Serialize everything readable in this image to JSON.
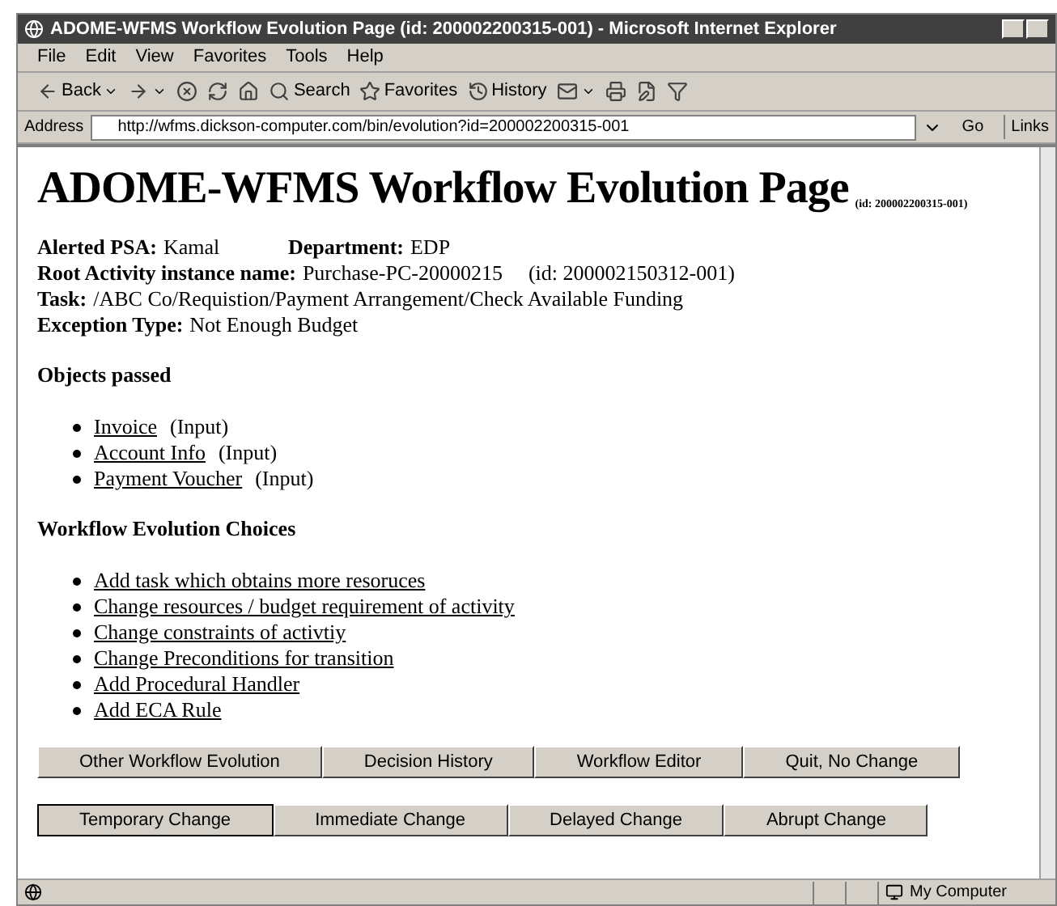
{
  "window": {
    "title": "ADOME-WFMS Workflow Evolution Page (id: 200002200315-001) - Microsoft Internet Explorer"
  },
  "menu": [
    "File",
    "Edit",
    "View",
    "Favorites",
    "Tools",
    "Help"
  ],
  "toolbar": [
    {
      "kind": "back",
      "label": "Back"
    },
    {
      "kind": "forward"
    },
    {
      "kind": "stop"
    },
    {
      "kind": "refresh"
    },
    {
      "kind": "home"
    },
    {
      "kind": "search",
      "label": "Search"
    },
    {
      "kind": "favorites",
      "label": "Favorites"
    },
    {
      "kind": "history",
      "label": "History"
    },
    {
      "kind": "mail"
    },
    {
      "kind": "print"
    },
    {
      "kind": "edit"
    },
    {
      "kind": "funnel"
    }
  ],
  "address": {
    "label": "Address",
    "value": "http://wfms.dickson-computer.com/bin/evolution?id=200002200315-001",
    "go": "Go",
    "links": "Links"
  },
  "page": {
    "heading": "ADOME-WFMS Workflow Evolution Page",
    "heading_id": "(id: 200002200315-001)",
    "info": [
      [
        {
          "label": "Alerted PSA:",
          "value": "Kamal"
        },
        {
          "label": "Department:",
          "value": "EDP"
        }
      ],
      [
        {
          "label": "Root Activity instance name:",
          "value": "Purchase-PC-20000215",
          "note": "(id: 200002150312-001)"
        }
      ],
      [
        {
          "label": "Task:",
          "value": "/ABC Co/Requistion/Payment Arrangement/Check Available Funding"
        }
      ],
      [
        {
          "label": "Exception Type:",
          "value": "Not Enough Budget"
        }
      ]
    ],
    "sections": [
      {
        "title": "Objects passed",
        "items": [
          {
            "link": "Invoice",
            "note": "(Input)"
          },
          {
            "link": "Account Info",
            "note": "(Input)"
          },
          {
            "link": "Payment Voucher",
            "note": "(Input)"
          }
        ]
      },
      {
        "title": "Workflow Evolution Choices",
        "items": [
          {
            "link": "Add task which obtains more resoruces"
          },
          {
            "link": "Change resources / budget requirement of activity"
          },
          {
            "link": "Change constraints of activtiy"
          },
          {
            "link": "Change Preconditions for transition"
          },
          {
            "link": "Add Procedural Handler"
          },
          {
            "link": "Add ECA Rule"
          }
        ]
      }
    ],
    "button_rows": [
      [
        {
          "label": "Other Workflow Evolution",
          "default": false
        },
        {
          "label": "Decision History",
          "default": false
        },
        {
          "label": "Workflow Editor",
          "default": false
        },
        {
          "label": "Quit, No Change",
          "default": false
        }
      ],
      [
        {
          "label": "Temporary Change",
          "default": true
        },
        {
          "label": "Immediate Change",
          "default": false
        },
        {
          "label": "Delayed Change",
          "default": false
        },
        {
          "label": "Abrupt Change",
          "default": false
        }
      ]
    ]
  },
  "status_bar": {
    "zone": "My Computer"
  }
}
